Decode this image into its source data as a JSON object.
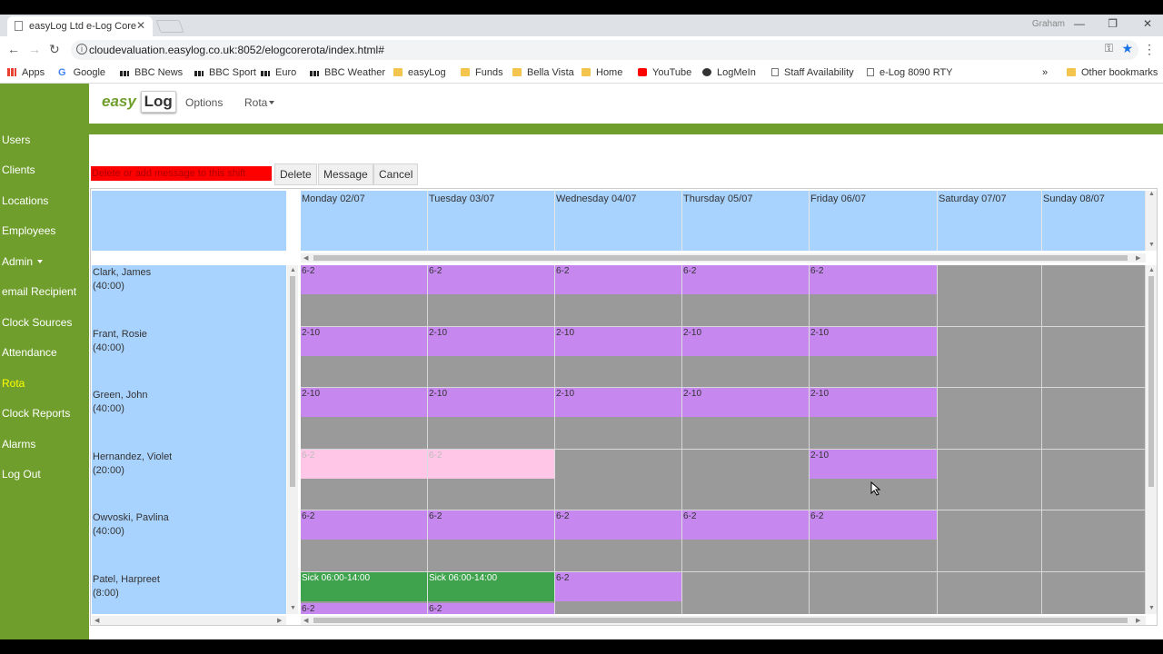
{
  "browser": {
    "tab_title": "easyLog Ltd e-Log Core",
    "tab_close": "✕",
    "user": "Graham",
    "url": "cloudevaluation.easylog.co.uk:8052/elogcorerota/index.html#",
    "bookmarks": [
      "Apps",
      "Google",
      "BBC News",
      "BBC Sport",
      "Euro",
      "BBC Weather",
      "easyLog",
      "Funds",
      "Bella Vista",
      "Home",
      "YouTube",
      "LogMeIn",
      "Staff Availability",
      "e-Log 8090 RTY"
    ],
    "bookmarks_more": "»",
    "other_bookmarks": "Other bookmarks"
  },
  "app": {
    "logo_easy": "easy",
    "logo_log": "Log",
    "nav_options": "Options",
    "nav_rota": "Rota",
    "sidebar": [
      "Users",
      "Clients",
      "Locations",
      "Employees",
      "Admin",
      "email Recipient",
      "Clock Sources",
      "Attendance",
      "Rota",
      "Clock Reports",
      "Alarms",
      "Log Out"
    ],
    "sidebar_active": "Rota",
    "action_label": "Delete or add message to this shift",
    "buttons": {
      "delete": "Delete",
      "message": "Message",
      "cancel": "Cancel"
    }
  },
  "rota": {
    "days": [
      "Monday 02/07",
      "Tuesday 03/07",
      "Wednesday 04/07",
      "Thursday 05/07",
      "Friday 06/07",
      "Saturday 07/07",
      "Sunday 08/07"
    ],
    "employees": [
      {
        "name": "Clark, James",
        "hours": "(40:00)",
        "shifts": [
          "6-2",
          "6-2",
          "6-2",
          "6-2",
          "6-2",
          "",
          ""
        ]
      },
      {
        "name": "Frant, Rosie",
        "hours": "(40:00)",
        "shifts": [
          "2-10",
          "2-10",
          "2-10",
          "2-10",
          "2-10",
          "",
          ""
        ]
      },
      {
        "name": "Green, John",
        "hours": "(40:00)",
        "shifts": [
          "2-10",
          "2-10",
          "2-10",
          "2-10",
          "2-10",
          "",
          ""
        ]
      },
      {
        "name": "Hernandez, Violet",
        "hours": "(20:00)",
        "shifts": [
          "6-2",
          "6-2",
          "",
          "",
          "2-10",
          "",
          ""
        ],
        "pink": [
          0,
          1
        ]
      },
      {
        "name": "Owvoski, Pavlina",
        "hours": "(40:00)",
        "shifts": [
          "6-2",
          "6-2",
          "6-2",
          "6-2",
          "6-2",
          "",
          ""
        ]
      },
      {
        "name": "Patel, Harpreet",
        "hours": "(8:00)",
        "shifts": [
          "Sick 06:00-14:00",
          "Sick 06:00-14:00",
          "6-2",
          "",
          "",
          "",
          ""
        ],
        "green": [
          0,
          1
        ]
      }
    ],
    "partial_row_shifts": [
      "6-2",
      "6-2"
    ]
  },
  "colors": {
    "sidebar": "#6f9e2c",
    "header_blue": "#a9d3ff",
    "shift_purple": "#c687ef",
    "shift_pink": "#ffc6e8",
    "shift_green": "#3fa34d",
    "empty_gray": "#9a9a9a",
    "active_yellow": "#ffff00"
  }
}
